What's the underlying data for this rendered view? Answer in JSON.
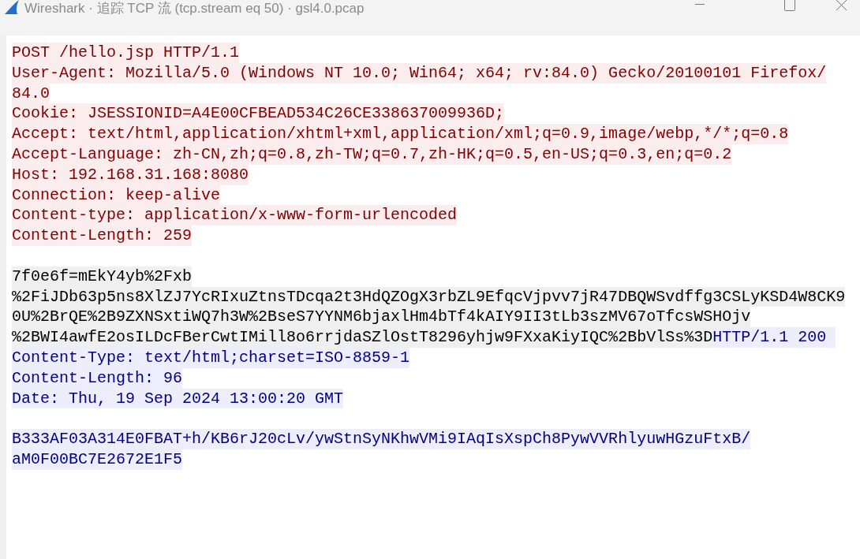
{
  "window": {
    "title": "Wireshark · 追踪 TCP 流 (tcp.stream eq 50) · gsl4.0.pcap"
  },
  "stream": [
    {
      "kind": "text",
      "segments": [
        {
          "kind": "client",
          "text": "POST /hello.jsp HTTP/1.1"
        }
      ]
    },
    {
      "kind": "text",
      "segments": [
        {
          "kind": "client",
          "text": "User-Agent: Mozilla/5.0 (Windows NT 10.0; Win64; x64; rv:84.0) Gecko/20100101 Firefox/"
        }
      ]
    },
    {
      "kind": "text",
      "segments": [
        {
          "kind": "client",
          "text": "84.0"
        }
      ]
    },
    {
      "kind": "text",
      "segments": [
        {
          "kind": "client",
          "text": "Cookie: JSESSIONID=A4E00CFBEAD534C26CE338637009936D;"
        }
      ]
    },
    {
      "kind": "text",
      "segments": [
        {
          "kind": "client",
          "text": "Accept: text/html,application/xhtml+xml,application/xml;q=0.9,image/webp,*/*;q=0.8"
        }
      ]
    },
    {
      "kind": "text",
      "segments": [
        {
          "kind": "client",
          "text": "Accept-Language: zh-CN,zh;q=0.8,zh-TW;q=0.7,zh-HK;q=0.5,en-US;q=0.3,en;q=0.2"
        }
      ]
    },
    {
      "kind": "text",
      "segments": [
        {
          "kind": "client",
          "text": "Host: 192.168.31.168:8080"
        }
      ]
    },
    {
      "kind": "text",
      "segments": [
        {
          "kind": "client",
          "text": "Connection: keep-alive"
        }
      ]
    },
    {
      "kind": "text",
      "segments": [
        {
          "kind": "client",
          "text": "Content-type: application/x-www-form-urlencoded"
        }
      ]
    },
    {
      "kind": "text",
      "segments": [
        {
          "kind": "client",
          "text": "Content-Length: 259"
        }
      ]
    },
    {
      "kind": "blank"
    },
    {
      "kind": "text",
      "segments": [
        {
          "kind": "plain",
          "text": "7f0e6f=mEkY4yb%2Fxb"
        }
      ]
    },
    {
      "kind": "text",
      "segments": [
        {
          "kind": "plain",
          "text": "%2FiJDb63p5ns8XlZJ7YcRIxuZtnsTDcqa2t3HdQZOgX3rbZL9EfqcVjpvv7jR47DBQWSvdffg3CSLyKSD4W8CK9"
        }
      ]
    },
    {
      "kind": "text",
      "segments": [
        {
          "kind": "plain",
          "text": "0U%2BrQE%2B9ZXNSxtiWQ7h3W%2BseS7YYNM6bjaxlHm4bTf4kAIY9II3tLb3szMV67oTfcsWSHOjv"
        }
      ]
    },
    {
      "kind": "text",
      "segments": [
        {
          "kind": "plain",
          "text": "%2BWI4awfE2osILDcFBerCwtIMill8o6rrjdaSZlOstT8296yhjw9FXxaKiyIQC%2BbVlSs%3D"
        },
        {
          "kind": "server",
          "text": "HTTP/1.1 200 "
        }
      ]
    },
    {
      "kind": "text",
      "segments": [
        {
          "kind": "server",
          "text": "Content-Type: text/html;charset=ISO-8859-1"
        }
      ]
    },
    {
      "kind": "text",
      "segments": [
        {
          "kind": "server",
          "text": "Content-Length: 96"
        }
      ]
    },
    {
      "kind": "text",
      "segments": [
        {
          "kind": "server",
          "text": "Date: Thu, 19 Sep 2024 13:00:20 GMT"
        }
      ]
    },
    {
      "kind": "blank"
    },
    {
      "kind": "text",
      "segments": [
        {
          "kind": "server",
          "text": "B333AF03A314E0FBAT+h/KB6rJ20cLv/ywStnSyNKhwVMi9IAqIsXspCh8PywVVRhlyuwHGzuFtxB/"
        }
      ]
    },
    {
      "kind": "text",
      "segments": [
        {
          "kind": "server",
          "text": "aM0F00BC7E2672E1F5"
        }
      ]
    }
  ]
}
